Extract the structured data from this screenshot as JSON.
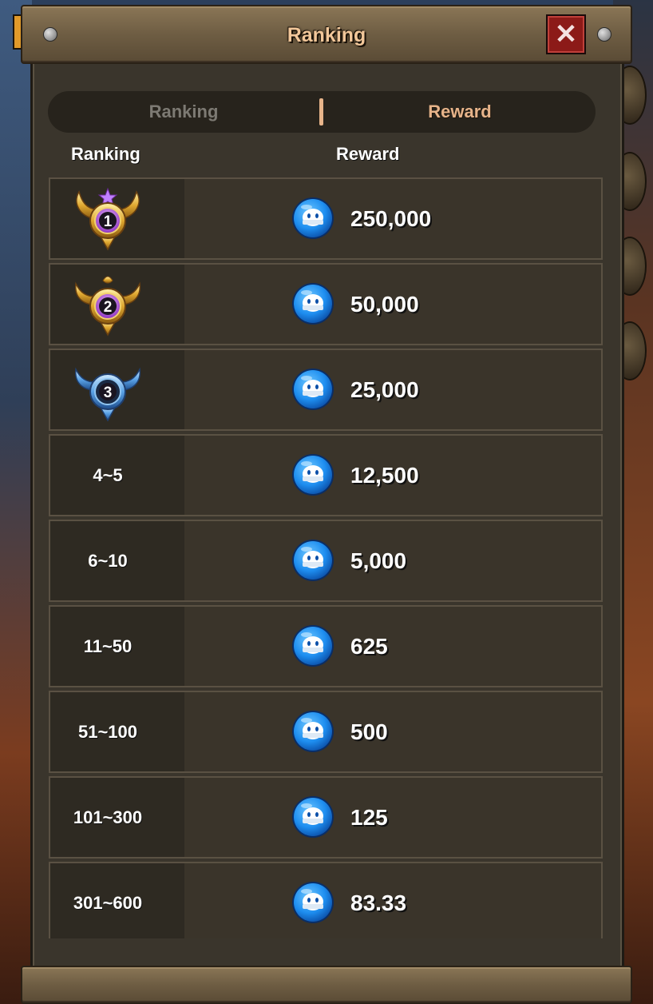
{
  "window": {
    "title": "Ranking",
    "close_icon": "close-icon"
  },
  "tabs": [
    {
      "label": "Ranking",
      "active": false
    },
    {
      "label": "Reward",
      "active": true
    }
  ],
  "columns": {
    "ranking": "Ranking",
    "reward": "Reward"
  },
  "reward_icon": "blue-gem-currency-icon",
  "rows": [
    {
      "rank": "1",
      "rank_icon": "gold-winged-rank-1-badge",
      "amount": "250,000"
    },
    {
      "rank": "2",
      "rank_icon": "gold-horned-rank-2-badge",
      "amount": "50,000"
    },
    {
      "rank": "3",
      "rank_icon": "blue-winged-rank-3-badge",
      "amount": "25,000"
    },
    {
      "rank": "4~5",
      "amount": "12,500"
    },
    {
      "rank": "6~10",
      "amount": "5,000"
    },
    {
      "rank": "11~50",
      "amount": "625"
    },
    {
      "rank": "51~100",
      "amount": "500"
    },
    {
      "rank": "101~300",
      "amount": "125"
    },
    {
      "rank": "301~600",
      "amount": "83.33"
    }
  ],
  "colors": {
    "title": "#f2c79a",
    "active_tab": "#e7b48a",
    "inactive_tab": "#7d7a73",
    "close_button": "#8c1a18",
    "gem": "#1e8ef0"
  }
}
